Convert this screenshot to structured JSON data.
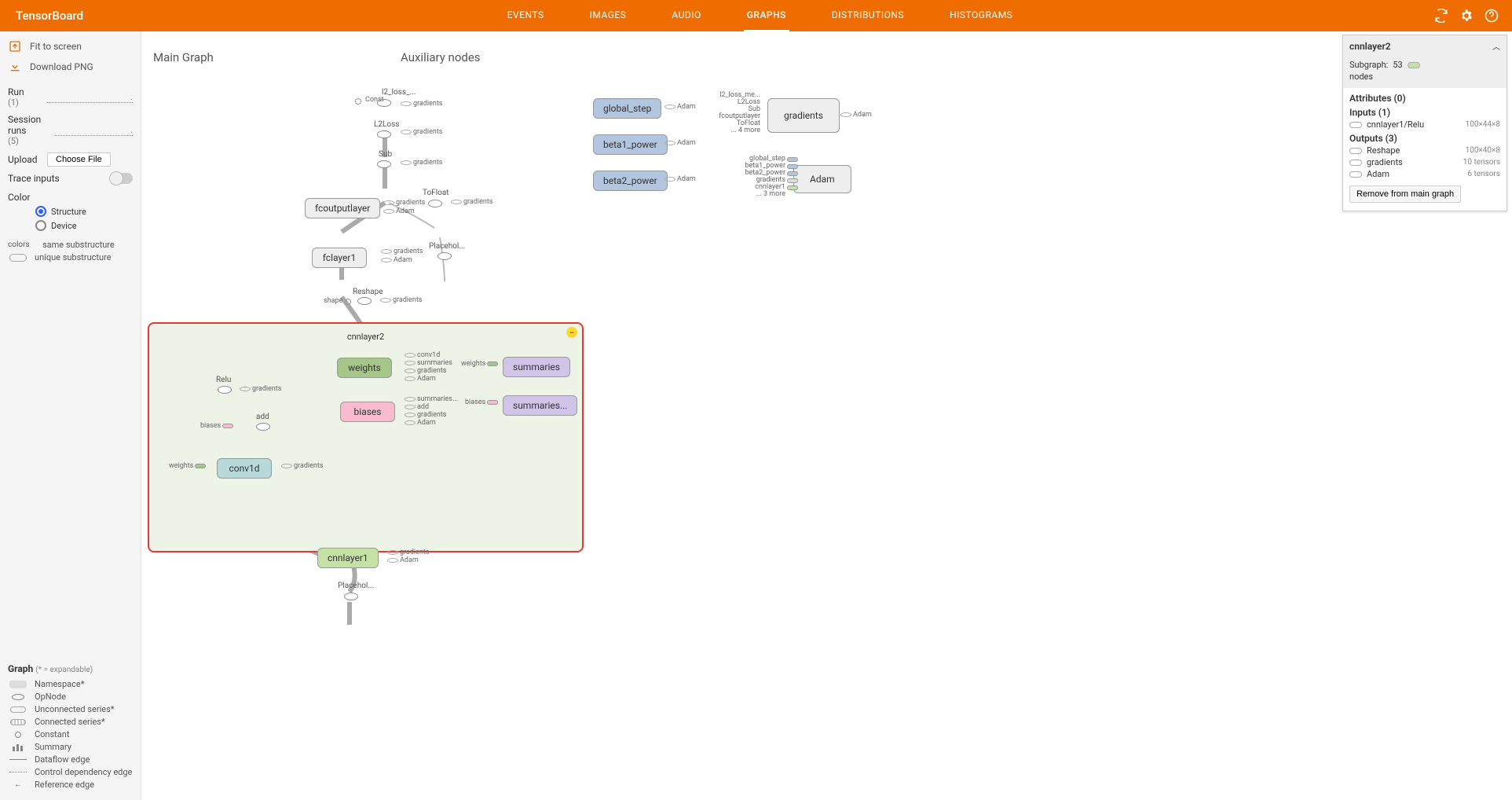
{
  "header": {
    "logo": "TensorBoard",
    "tabs": [
      "EVENTS",
      "IMAGES",
      "AUDIO",
      "GRAPHS",
      "DISTRIBUTIONS",
      "HISTOGRAMS"
    ],
    "active_tab": "GRAPHS"
  },
  "sidebar": {
    "fit_to_screen": "Fit to screen",
    "download_png": "Download PNG",
    "run_label": "Run",
    "run_count": "(1)",
    "session_label": "Session runs",
    "session_count": "(5)",
    "upload_label": "Upload",
    "choose_file": "Choose File",
    "trace_inputs": "Trace inputs",
    "color_label": "Color",
    "color_structure": "Structure",
    "color_device": "Device",
    "colors_label": "colors",
    "same_sub": "same substructure",
    "unique_sub": "unique substructure",
    "graph_legend_label": "Graph",
    "graph_legend_note": "(* = expandable)",
    "legend": {
      "namespace": "Namespace*",
      "opnode": "OpNode",
      "unc_series": "Unconnected series*",
      "con_series": "Connected series*",
      "constant": "Constant",
      "summary": "Summary",
      "dataflow": "Dataflow edge",
      "controldep": "Control dependency edge",
      "reference": "Reference edge"
    }
  },
  "graph": {
    "main_title": "Main Graph",
    "aux_title": "Auxiliary nodes",
    "l2_loss_top": "l2_loss_...",
    "const_lbl": "Const",
    "gradients_lbl": "gradients",
    "l2loss": "L2Loss",
    "sub": "Sub",
    "tofloat": "ToFloat",
    "fcoutputlayer": "fcoutputlayer",
    "adam_lbl": "Adam",
    "fclayer1": "fclayer1",
    "placehol": "Placehol...",
    "reshape": "Reshape",
    "shape_lbl": "shape",
    "cnnlayer2": "cnnlayer2",
    "relu": "Relu",
    "add": "add",
    "biases_lbl": "biases",
    "weights_lbl": "weights",
    "conv1d": "conv1d",
    "weights": "weights",
    "biases": "biases",
    "summaries": "summaries",
    "summaries_dot": "summaries...",
    "sum_conv1d": "conv1d",
    "sum_summaries": "summaries",
    "sum_gradients": "gradients",
    "sum_adam": "Adam",
    "b_summaries": "summaries...",
    "b_add": "add",
    "b_gradients": "gradients",
    "b_adam": "Adam",
    "cnnlayer1": "cnnlayer1",
    "global_step": "global_step",
    "beta1_power": "beta1_power",
    "beta2_power": "beta2_power",
    "gradients_node": "gradients",
    "adam_node": "Adam",
    "grad_in1": "l2_loss_me...",
    "grad_in2": "L2Loss",
    "grad_in3": "Sub",
    "grad_in4": "fcoutputlayer",
    "grad_in5": "ToFloat",
    "grad_more": "... 4 more",
    "adam_in1": "global_step",
    "adam_in2": "beta1_power",
    "adam_in3": "beta2_power",
    "adam_in4": "gradients",
    "adam_in5": "cnnlayer1",
    "adam_more": "... 3 more"
  },
  "details": {
    "title": "cnnlayer2",
    "subgraph_label": "Subgraph: ",
    "subgraph_count": "53",
    "nodes_label": "nodes",
    "attributes": "Attributes (0)",
    "inputs": "Inputs (1)",
    "input1": "cnnlayer1/Relu",
    "input1_dim": "100×44×8",
    "outputs": "Outputs (3)",
    "out1": "Reshape",
    "out1_dim": "100×40×8",
    "out2": "gradients",
    "out2_dim": "10 tensors",
    "out3": "Adam",
    "out3_dim": "6 tensors",
    "remove": "Remove from main graph"
  }
}
